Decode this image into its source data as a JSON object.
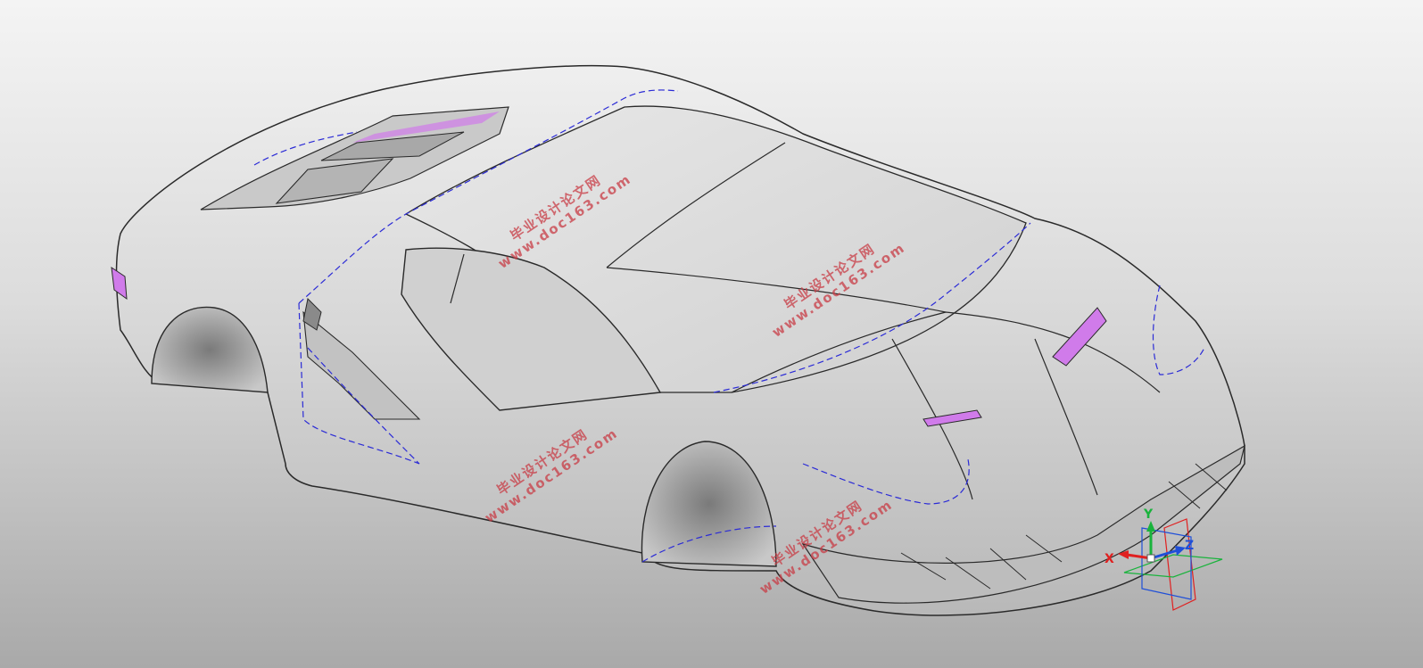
{
  "window": {
    "type": "cad-3d-viewport"
  },
  "model": {
    "icon": "car-body-surface-model"
  },
  "colors": {
    "background_top": "#f4f4f4",
    "background_bottom": "#a9a9a9",
    "body_fill": "#d9d9d9",
    "edge_line": "#2a2a2a",
    "construction_line": "#2b2bd6",
    "highlight_surface": "#d07bea",
    "watermark": "#c83c46",
    "axis_x": "#e02020",
    "axis_y": "#19b33c",
    "axis_z": "#1f4fd8"
  },
  "watermarks": [
    {
      "cn": "毕业设计论文网",
      "url": "www.doc163.com"
    },
    {
      "cn": "毕业设计论文网",
      "url": "www.doc163.com"
    },
    {
      "cn": "毕业设计论文网",
      "url": "www.doc163.com"
    },
    {
      "cn": "毕业设计论文网",
      "url": "www.doc163.com"
    }
  ],
  "axis_triad": {
    "icon": "coordinate-triad-icon",
    "labels": {
      "x": "X",
      "y": "Y",
      "z": "Z"
    }
  }
}
